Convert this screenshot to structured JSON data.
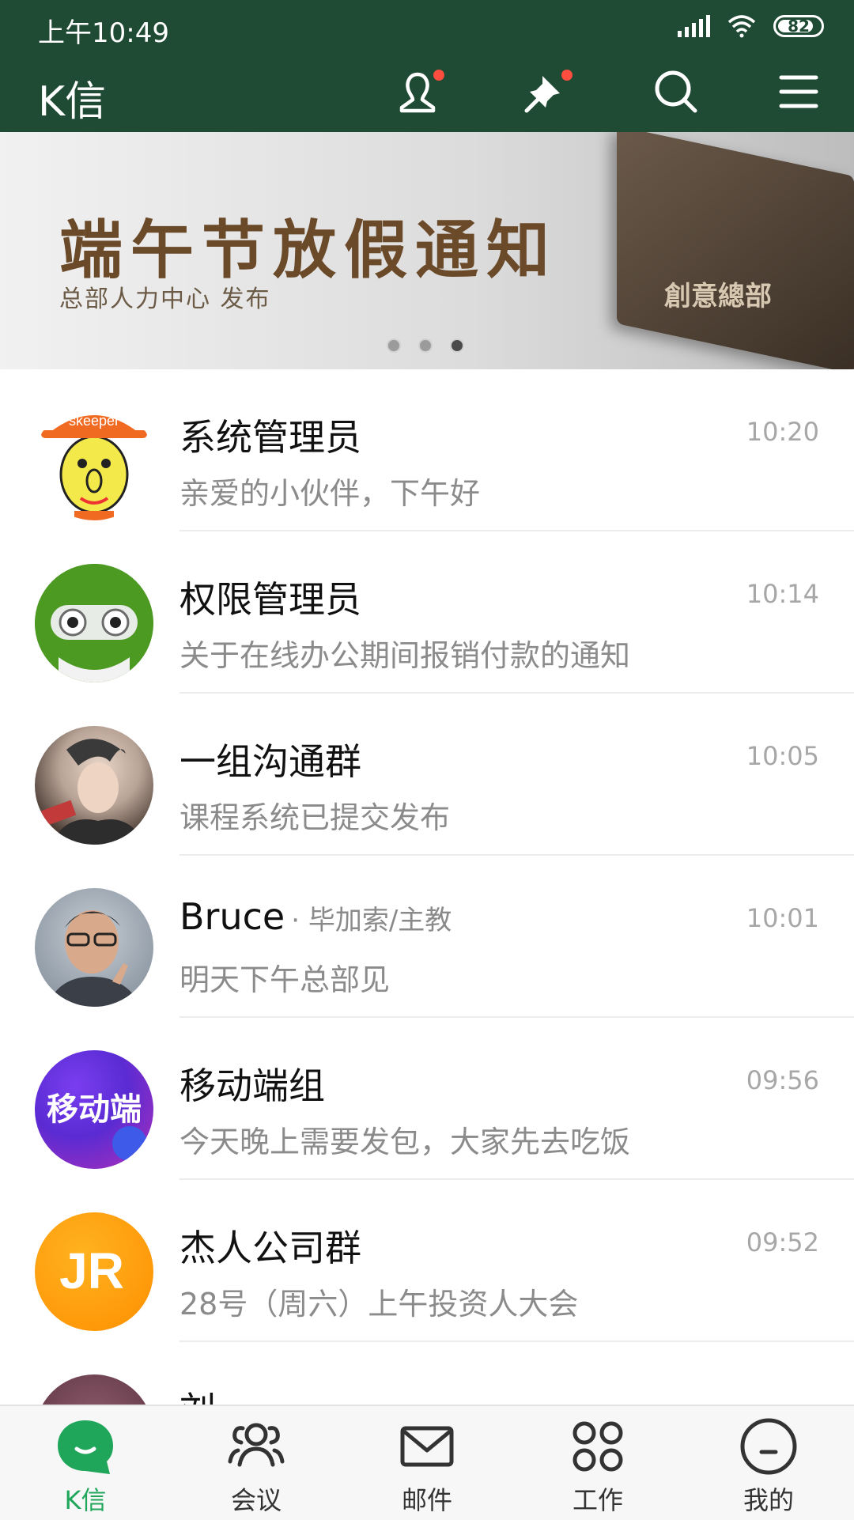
{
  "status_bar": {
    "time": "上午10:49",
    "battery": "82"
  },
  "app_bar": {
    "title": "K信",
    "icons": [
      "contacts-icon",
      "pin-icon",
      "search-icon",
      "menu-icon"
    ]
  },
  "banner": {
    "title": "端午节放假通知",
    "subtitle": "总部人力中心  发布",
    "plaque_text": "創意總部",
    "page_count": 3,
    "active_page": 3
  },
  "chats": [
    {
      "name": "系统管理员",
      "role": "",
      "time": "10:20",
      "message": "亲爱的小伙伴，下午好",
      "avatar": "skeeper-avatar",
      "avatar_text": "skeeper"
    },
    {
      "name": "权限管理员",
      "role": "",
      "time": "10:14",
      "message": "关于在线办公期间报销付款的通知",
      "avatar": "robot-avatar",
      "avatar_text": ""
    },
    {
      "name": "一组沟通群",
      "role": "",
      "time": "10:05",
      "message": "课程系统已提交发布",
      "avatar": "photo-avatar",
      "avatar_text": ""
    },
    {
      "name": "Bruce",
      "role": "· 毕加索/主教",
      "time": "10:01",
      "message": "明天下午总部见",
      "avatar": "photo-avatar",
      "avatar_text": ""
    },
    {
      "name": "移动端组",
      "role": "",
      "time": "09:56",
      "message": "今天晚上需要发包，大家先去吃饭",
      "avatar": "text-avatar",
      "avatar_text": "移动端"
    },
    {
      "name": "杰人公司群",
      "role": "",
      "time": "09:52",
      "message": "28号（周六）上午投资人大会",
      "avatar": "text-avatar",
      "avatar_text": "JR"
    },
    {
      "name": "刘",
      "role": "",
      "time": "",
      "message": "",
      "avatar": "photo-avatar",
      "avatar_text": ""
    }
  ],
  "tabs": [
    {
      "label": "K信",
      "icon": "chat-bubble-icon",
      "active": true
    },
    {
      "label": "会议",
      "icon": "people-icon",
      "active": false
    },
    {
      "label": "邮件",
      "icon": "mail-icon",
      "active": false
    },
    {
      "label": "工作",
      "icon": "grid-icon",
      "active": false
    },
    {
      "label": "我的",
      "icon": "profile-icon",
      "active": false
    }
  ],
  "colors": {
    "header": "#1f4a33",
    "accent": "#20a65a",
    "badge": "#ff4d3f"
  }
}
